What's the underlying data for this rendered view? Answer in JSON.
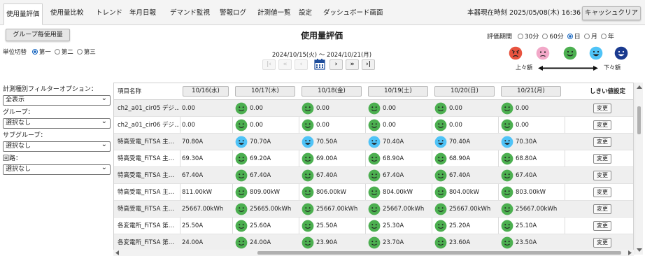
{
  "nav": {
    "tabs": [
      {
        "label": "使用量評価",
        "active": true
      },
      {
        "label": "使用量比較"
      },
      {
        "label": "トレンド"
      },
      {
        "label": "年月日報"
      },
      {
        "label": "デマンド監視"
      },
      {
        "label": "警報ログ"
      },
      {
        "label": "計測値一覧"
      },
      {
        "label": "設定"
      },
      {
        "label": "ダッシュボード画面"
      }
    ],
    "current_time": "本器現在時刻 2025/05/08(木) 16:36",
    "cache_clear": "キャッシュクリア"
  },
  "toolbar": {
    "group_button": "グループ毎使用量",
    "unit_label": "単位切替",
    "unit_options": [
      "第一",
      "第二",
      "第三"
    ],
    "unit_selected": "第一"
  },
  "header": {
    "title": "使用量評価",
    "date_range": "2024/10/15(火) ～ 2024/10/21(月)"
  },
  "period": {
    "label": "評価期間",
    "options": [
      "30分",
      "60分",
      "日",
      "月",
      "年"
    ],
    "selected": "日"
  },
  "legend": {
    "faces": [
      "angry",
      "worried",
      "neutral",
      "happy",
      "very-happy"
    ],
    "face_colors": [
      "#e8533f",
      "#f2a8c8",
      "#4caf50",
      "#4fc3f7",
      "#1a3a8f"
    ],
    "left_label": "上々額",
    "right_label": "下々額"
  },
  "filters": {
    "measure_label": "計測種別フィルターオプション：",
    "measure_value": "全表示",
    "group_label": "グループ：",
    "group_value": "選択なし",
    "subgroup_label": "サブグループ：",
    "subgroup_value": "選択なし",
    "circuit_label": "回路：",
    "circuit_value": "選択なし"
  },
  "table": {
    "item_header": "項目名称",
    "date_headers": [
      "10/16(水)",
      "10/17(木)",
      "10/18(金)",
      "10/19(土)",
      "10/20(日)",
      "10/21(月)"
    ],
    "threshold_header": "しきい値設定",
    "change_label": "変更",
    "rows": [
      {
        "name": "ch2_a01_cir05 デジ…",
        "first": "0.00",
        "cells": [
          {
            "f": "green",
            "v": "0.00"
          },
          {
            "f": "green",
            "v": "0.00"
          },
          {
            "f": "green",
            "v": "0.00"
          },
          {
            "f": "green",
            "v": "0.00"
          },
          {
            "f": "green",
            "v": "0.00"
          }
        ]
      },
      {
        "name": "ch2_a01_cir06 デジ…",
        "first": "0.00",
        "cells": [
          {
            "f": "green",
            "v": "0.00"
          },
          {
            "f": "green",
            "v": "0.00"
          },
          {
            "f": "green",
            "v": "0.00"
          },
          {
            "f": "green",
            "v": "0.00"
          },
          {
            "f": "green",
            "v": "0.00"
          }
        ]
      },
      {
        "name": "特高受電_FiTSA 主…",
        "first": "70.80A",
        "cells": [
          {
            "f": "blue",
            "v": "70.70A"
          },
          {
            "f": "blue",
            "v": "70.50A"
          },
          {
            "f": "blue",
            "v": "70.40A"
          },
          {
            "f": "blue",
            "v": "70.40A"
          },
          {
            "f": "blue",
            "v": "70.30A"
          }
        ]
      },
      {
        "name": "特高受電_FiTSA 主…",
        "first": "69.30A",
        "cells": [
          {
            "f": "green",
            "v": "69.20A"
          },
          {
            "f": "green",
            "v": "69.00A"
          },
          {
            "f": "green",
            "v": "68.90A"
          },
          {
            "f": "green",
            "v": "68.90A"
          },
          {
            "f": "green",
            "v": "68.80A"
          }
        ]
      },
      {
        "name": "特高受電_FiTSA 主…",
        "first": "67.40A",
        "cells": [
          {
            "f": "green",
            "v": "67.40A"
          },
          {
            "f": "green",
            "v": "67.40A"
          },
          {
            "f": "green",
            "v": "67.40A"
          },
          {
            "f": "green",
            "v": "67.40A"
          },
          {
            "f": "green",
            "v": "67.40A"
          }
        ]
      },
      {
        "name": "特高受電_FiTSA 主…",
        "first": "811.00kW",
        "cells": [
          {
            "f": "green",
            "v": "809.00kW"
          },
          {
            "f": "green",
            "v": "806.00kW"
          },
          {
            "f": "green",
            "v": "804.00kW"
          },
          {
            "f": "green",
            "v": "804.00kW"
          },
          {
            "f": "green",
            "v": "803.00kW"
          }
        ]
      },
      {
        "name": "特高受電_FiTSA 主…",
        "first": "25667.00kWh",
        "cells": [
          {
            "f": "green",
            "v": "25665.00kWh"
          },
          {
            "f": "green",
            "v": "25667.00kWh"
          },
          {
            "f": "green",
            "v": "25667.00kWh"
          },
          {
            "f": "green",
            "v": "25667.00kWh"
          },
          {
            "f": "green",
            "v": "25667.00kWh"
          }
        ]
      },
      {
        "name": "各変電所_FiTSA 第…",
        "first": "25.50A",
        "cells": [
          {
            "f": "green",
            "v": "25.60A"
          },
          {
            "f": "green",
            "v": "25.50A"
          },
          {
            "f": "green",
            "v": "25.30A"
          },
          {
            "f": "green",
            "v": "25.20A"
          },
          {
            "f": "green",
            "v": "25.10A"
          }
        ]
      },
      {
        "name": "各変電所_FiTSA 第…",
        "first": "24.00A",
        "cells": [
          {
            "f": "green",
            "v": "24.00A"
          },
          {
            "f": "green",
            "v": "23.90A"
          },
          {
            "f": "green",
            "v": "23.70A"
          },
          {
            "f": "green",
            "v": "23.60A"
          },
          {
            "f": "green",
            "v": "23.50A"
          }
        ]
      }
    ]
  }
}
